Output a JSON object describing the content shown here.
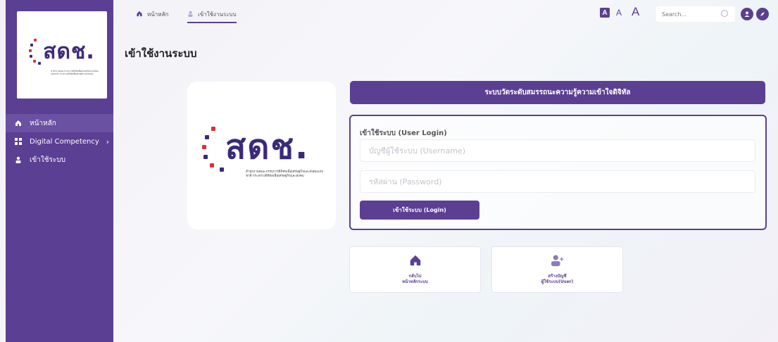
{
  "logo": {
    "text": "สดช.",
    "subtitle": "สำนักงานคณะกรรมการดิจิทัลเพื่อเศรษฐกิจและสังคมแห่งชาติ กระทรวงดิจิทัลเพื่อเศรษฐกิจและสังคม"
  },
  "sidebar": {
    "items": [
      {
        "label": "หน้าหลัก",
        "icon": "home-icon"
      },
      {
        "label": "Digital Competency",
        "icon": "grid-icon"
      },
      {
        "label": "เข้าใช้ระบบ",
        "icon": "user-icon"
      }
    ]
  },
  "topbar": {
    "crumbs": [
      {
        "label": "หน้าหลัก",
        "icon": "home-icon"
      },
      {
        "label": "เข้าใช้งานระบบ",
        "icon": "user-icon"
      }
    ],
    "font_sizes": [
      "A",
      "A",
      "A"
    ],
    "search_placeholder": "Search..."
  },
  "page_title": "เข้าใช้งานระบบ",
  "banner": "ระบบวัดระดับสมรรถนะความรู้ความเข้าใจดิจิทัล",
  "login": {
    "heading": "เข้าใช้ระบบ (User Login)",
    "username_placeholder": "บัญชีผู้ใช้ระบบ (Username)",
    "password_placeholder": "รหัสผ่าน (Password)",
    "button": "เข้าใช้ระบบ (Login)"
  },
  "cards": [
    {
      "line1": "กลับไป",
      "line2": "หน้าหลักระบบ",
      "icon": "home-icon"
    },
    {
      "line1": "สร้างบัญชี",
      "line2": "ผู้ใช้ระบบ(User)",
      "icon": "add-user-icon"
    }
  ],
  "colors": {
    "brand": "#5b3f93",
    "logo_text": "#3b2a7a",
    "accent_red": "#d8323a"
  }
}
